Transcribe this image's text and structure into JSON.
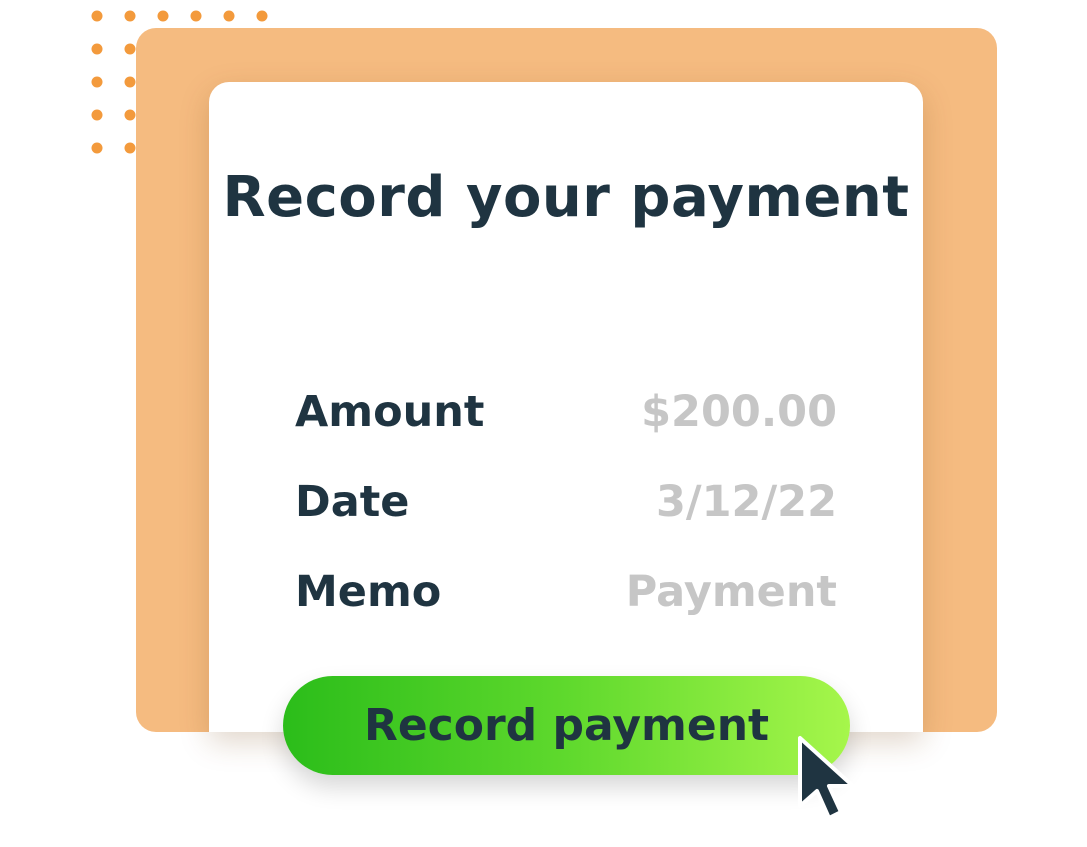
{
  "card": {
    "title": "Record your payment"
  },
  "fields": {
    "amount": {
      "label": "Amount",
      "value": "$200.00"
    },
    "date": {
      "label": "Date",
      "value": "3/12/22"
    },
    "memo": {
      "label": "Memo",
      "value": "Payment"
    }
  },
  "actions": {
    "record_label": "Record payment"
  },
  "colors": {
    "accent_orange": "#f5bb80",
    "dot_orange": "#f39a3c",
    "text_dark": "#1f3441",
    "text_muted": "#c6c6c6",
    "button_green_start": "#2bbd1a",
    "button_green_end": "#a6f64b"
  },
  "icons": {
    "pointer": "mouse-pointer-icon",
    "pattern": "dot-pattern"
  }
}
